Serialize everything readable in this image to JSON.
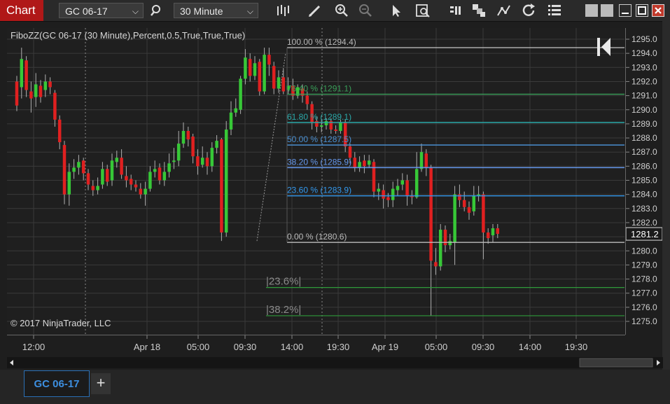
{
  "toolbar": {
    "chart_label": "Chart",
    "instrument": "GC 06-17",
    "interval": "30 Minute",
    "icons": [
      "bars-type-icon",
      "pencil-icon",
      "zoom-in-icon",
      "zoom-out-icon",
      "pointer-icon",
      "data-box-icon",
      "properties-icon",
      "strategies-icon",
      "indicators-icon",
      "reload-icon",
      "chart-list-icon"
    ]
  },
  "window_buttons": [
    "tile-icon",
    "tile-icon-2",
    "minimize-icon",
    "maximize-icon",
    "close-icon"
  ],
  "chart": {
    "indicator_label": "FiboZZ(GC 06-17 (30 Minute),Percent,0.5,True,True,True)",
    "copyright": "© 2017 NinjaTrader, LLC",
    "last_price": "1281.2",
    "price_ticks": [
      "1295.0",
      "1294.0",
      "1293.0",
      "1292.0",
      "1291.0",
      "1290.0",
      "1289.0",
      "1288.0",
      "1287.0",
      "1286.0",
      "1285.0",
      "1284.0",
      "1283.0",
      "1282.0",
      "1281.0",
      "1280.0",
      "1279.0",
      "1278.0",
      "1277.0",
      "1276.0",
      "1275.0"
    ],
    "time_ticks": [
      "12:00",
      "Apr 18",
      "05:00",
      "09:30",
      "14:00",
      "19:30",
      "Apr 19",
      "05:00",
      "09:30",
      "14:00",
      "19:30"
    ],
    "fib_levels": [
      {
        "label": "100.00 % (1294.4)",
        "price": 1294.4,
        "color": "#b8b8b8"
      },
      {
        "label": "76.40 % (1291.1)",
        "price": 1291.1,
        "color": "#3aa05a"
      },
      {
        "label": "61.80 % (1289.1)",
        "price": 1289.1,
        "color": "#2aa8a8"
      },
      {
        "label": "50.00 % (1287.5)",
        "price": 1287.5,
        "color": "#4a8fd0"
      },
      {
        "label": "38.20 % (1285.9)",
        "price": 1285.9,
        "color": "#6699ee"
      },
      {
        "label": "23.60 % (1283.9)",
        "price": 1283.9,
        "color": "#3399ee"
      },
      {
        "label": "0.00 % (1280.6)",
        "price": 1280.6,
        "color": "#bbbbbb"
      }
    ],
    "ext_levels": [
      {
        "label": "|23.6%|",
        "price": 1277.4,
        "color": "#2f9a3a"
      },
      {
        "label": "|38.2%|",
        "price": 1275.4,
        "color": "#2f9a3a"
      }
    ],
    "colors": {
      "up": "#37c837",
      "down": "#e02020",
      "wick": "#b0b0b0",
      "grid": "#3a3a3a",
      "text": "#cfcfcf"
    }
  },
  "tabs": {
    "active": "GC 06-17",
    "add": "+"
  }
}
